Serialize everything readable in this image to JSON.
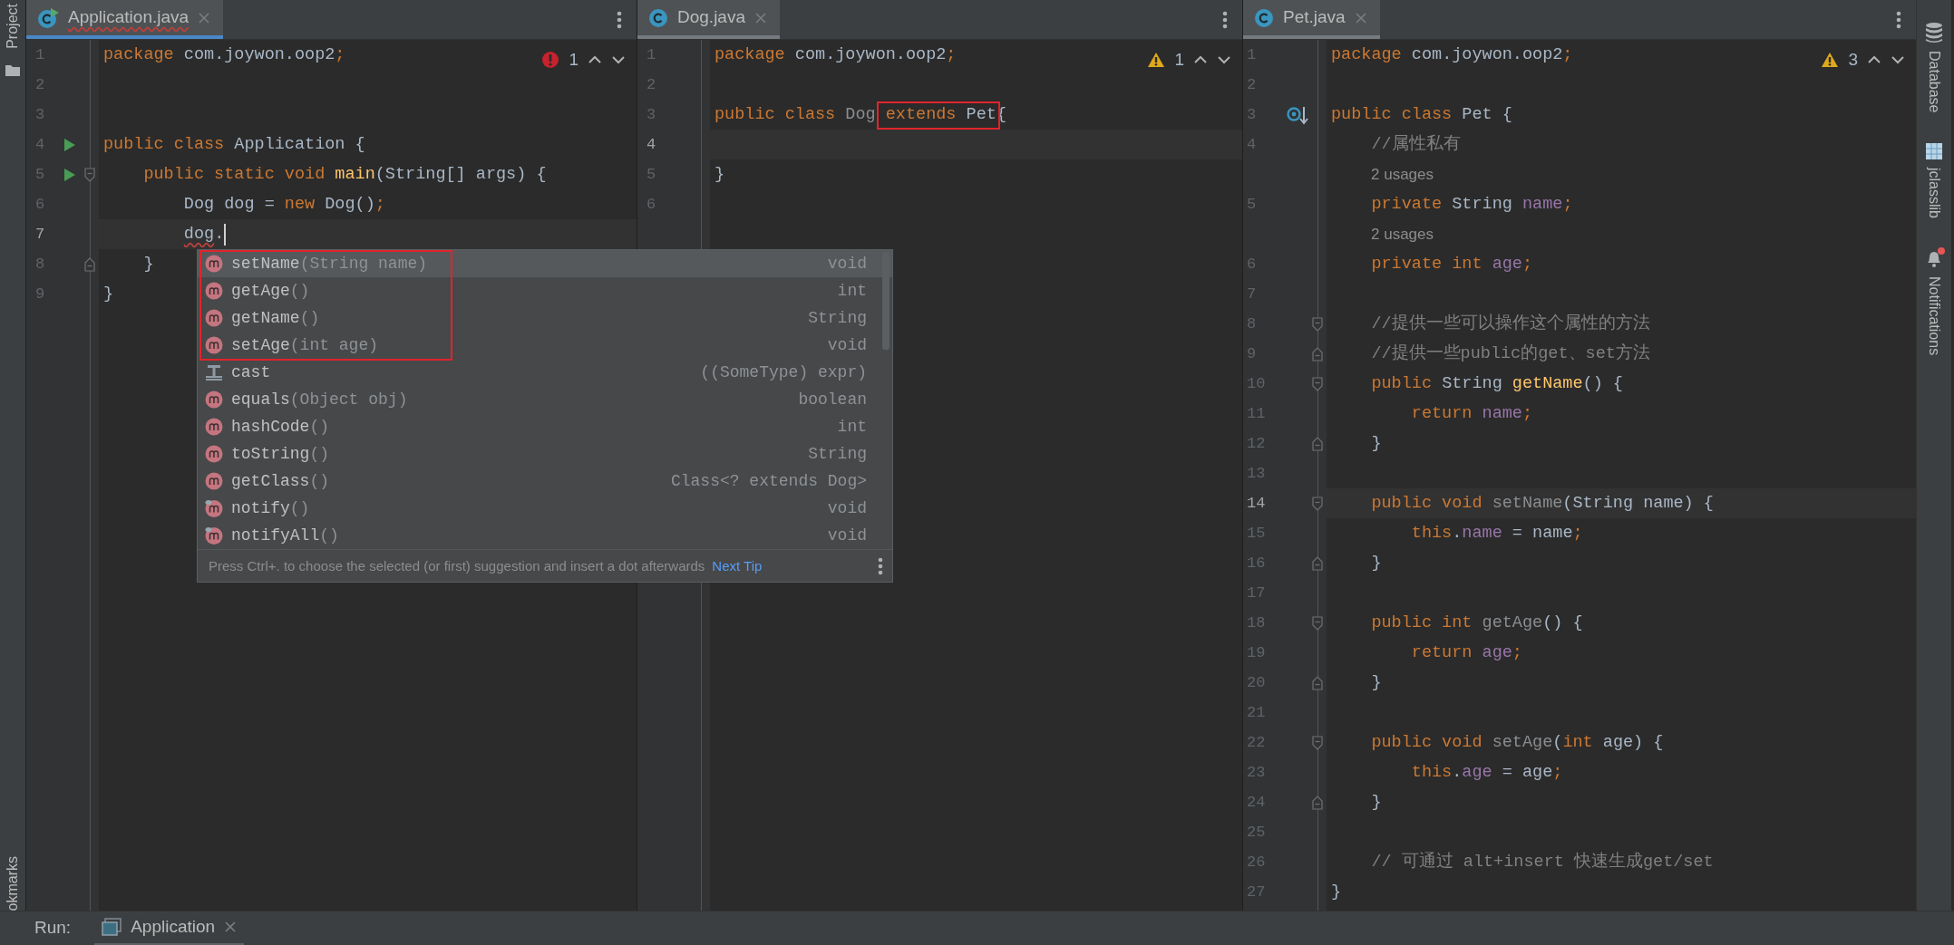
{
  "left_stripe": {
    "items": [
      {
        "label": "Project",
        "kind": "folder"
      }
    ],
    "bottom_label": "okmarks"
  },
  "panes": [
    {
      "tab": {
        "label": "Application.java",
        "kind": "runnable-class",
        "selected": true,
        "focused": true,
        "error": true
      },
      "inspection": {
        "kind": "error",
        "count": "1"
      },
      "lines": [
        {
          "n": "1",
          "current": false,
          "tokens": [
            {
              "kind": "kw",
              "text": "package"
            },
            {
              "kind": "id",
              "text": " com.joywon.oop2"
            },
            {
              "kind": "kw",
              "text": ";"
            }
          ]
        },
        {
          "n": "2",
          "current": false
        },
        {
          "n": "3",
          "current": false
        },
        {
          "n": "4",
          "current": false,
          "gutter_icon": {
            "kind": "run"
          },
          "tokens": [
            {
              "kind": "kw",
              "text": "public class "
            },
            {
              "kind": "id",
              "text": "Application {"
            }
          ]
        },
        {
          "n": "5",
          "current": false,
          "gutter_icon": {
            "kind": "run"
          },
          "fold": {
            "kind": "start"
          },
          "tokens": [
            {
              "kind": "kw",
              "text": "    public static void "
            },
            {
              "kind": "fn",
              "text": "main"
            },
            {
              "kind": "id",
              "text": "(String[] args) {"
            }
          ]
        },
        {
          "n": "6",
          "current": false,
          "tokens": [
            {
              "kind": "id",
              "text": "        Dog dog = "
            },
            {
              "kind": "kw",
              "text": "new "
            },
            {
              "kind": "id",
              "text": "Dog()"
            },
            {
              "kind": "kw",
              "text": ";"
            }
          ]
        },
        {
          "n": "7",
          "current": true,
          "tokens": [
            {
              "kind": "err",
              "text": "        dog"
            },
            {
              "kind": "id",
              "text": "."
            }
          ]
        },
        {
          "n": "8",
          "current": false,
          "fold": {
            "kind": "end"
          },
          "tokens": [
            {
              "kind": "id",
              "text": "    }"
            }
          ]
        },
        {
          "n": "9",
          "current": false,
          "tokens": [
            {
              "kind": "id",
              "text": "}"
            }
          ]
        }
      ]
    },
    {
      "tab": {
        "label": "Dog.java",
        "kind": "class",
        "selected": true,
        "focused": false,
        "error": false
      },
      "inspection": {
        "kind": "warning",
        "count": "1"
      },
      "lines": [
        {
          "n": "1",
          "current": false,
          "tokens": [
            {
              "kind": "kw",
              "text": "package"
            },
            {
              "kind": "id",
              "text": " com.joywon.oop2"
            },
            {
              "kind": "kw",
              "text": ";"
            }
          ]
        },
        {
          "n": "2",
          "current": false
        },
        {
          "n": "3",
          "current": false,
          "tokens": [
            {
              "kind": "kw",
              "text": "public class "
            },
            {
              "kind": "unused",
              "text": "Dog "
            },
            {
              "kind": "kw",
              "text": "extends",
              "boxed": true
            },
            {
              "kind": "id",
              "text": " Pet",
              "boxed": true
            },
            {
              "kind": "id",
              "text": "{"
            }
          ]
        },
        {
          "n": "4",
          "current": true
        },
        {
          "n": "5",
          "current": false,
          "tokens": [
            {
              "kind": "id",
              "text": "}"
            }
          ]
        },
        {
          "n": "6",
          "current": false
        }
      ]
    },
    {
      "tab": {
        "label": "Pet.java",
        "kind": "class",
        "selected": true,
        "focused": false,
        "error": false
      },
      "inspection": {
        "kind": "warning",
        "count": "3"
      },
      "lines": [
        {
          "n": "1",
          "current": false,
          "tokens": [
            {
              "kind": "kw",
              "text": "package"
            },
            {
              "kind": "id",
              "text": " com.joywon.oop2"
            },
            {
              "kind": "kw",
              "text": ";"
            }
          ]
        },
        {
          "n": "2",
          "current": false
        },
        {
          "n": "3",
          "current": false,
          "gutter_icon": {
            "kind": "override"
          },
          "tokens": [
            {
              "kind": "kw",
              "text": "public class "
            },
            {
              "kind": "id",
              "text": "Pet {"
            }
          ]
        },
        {
          "n": "4",
          "current": false,
          "tokens": [
            {
              "kind": "cm",
              "text": "    //属性私有"
            }
          ]
        },
        {
          "hint": "2 usages"
        },
        {
          "n": "5",
          "current": false,
          "tokens": [
            {
              "kind": "kw",
              "text": "    private "
            },
            {
              "kind": "id",
              "text": "String "
            },
            {
              "kind": "fld",
              "text": "name"
            },
            {
              "kind": "kw",
              "text": ";"
            }
          ]
        },
        {
          "hint": "2 usages"
        },
        {
          "n": "6",
          "current": false,
          "tokens": [
            {
              "kind": "kw",
              "text": "    private int "
            },
            {
              "kind": "fld",
              "text": "age"
            },
            {
              "kind": "kw",
              "text": ";"
            }
          ]
        },
        {
          "n": "7",
          "current": false
        },
        {
          "n": "8",
          "current": false,
          "fold": {
            "kind": "start"
          },
          "tokens": [
            {
              "kind": "cm",
              "text": "    //提供一些可以操作这个属性的方法"
            }
          ]
        },
        {
          "n": "9",
          "current": false,
          "fold": {
            "kind": "end"
          },
          "tokens": [
            {
              "kind": "cm",
              "text": "    //提供一些public的get、set方法"
            }
          ]
        },
        {
          "n": "10",
          "current": false,
          "fold": {
            "kind": "start"
          },
          "tokens": [
            {
              "kind": "kw",
              "text": "    public "
            },
            {
              "kind": "id",
              "text": "String "
            },
            {
              "kind": "fn",
              "text": "getName"
            },
            {
              "kind": "id",
              "text": "() {"
            }
          ]
        },
        {
          "n": "11",
          "current": false,
          "tokens": [
            {
              "kind": "kw",
              "text": "        return "
            },
            {
              "kind": "fld",
              "text": "name"
            },
            {
              "kind": "kw",
              "text": ";"
            }
          ]
        },
        {
          "n": "12",
          "current": false,
          "fold": {
            "kind": "end"
          },
          "tokens": [
            {
              "kind": "id",
              "text": "    }"
            }
          ]
        },
        {
          "n": "13",
          "current": false
        },
        {
          "n": "14",
          "current": true,
          "fold": {
            "kind": "start"
          },
          "tokens": [
            {
              "kind": "kw",
              "text": "    public void "
            },
            {
              "kind": "unused",
              "text": "setName"
            },
            {
              "kind": "id",
              "text": "(String name) {"
            }
          ]
        },
        {
          "n": "15",
          "current": false,
          "tokens": [
            {
              "kind": "kw",
              "text": "        this"
            },
            {
              "kind": "id",
              "text": "."
            },
            {
              "kind": "fld",
              "text": "name"
            },
            {
              "kind": "id",
              "text": " = name"
            },
            {
              "kind": "kw",
              "text": ";"
            }
          ]
        },
        {
          "n": "16",
          "current": false,
          "fold": {
            "kind": "end"
          },
          "tokens": [
            {
              "kind": "id",
              "text": "    }"
            }
          ]
        },
        {
          "n": "17",
          "current": false
        },
        {
          "n": "18",
          "current": false,
          "fold": {
            "kind": "start"
          },
          "tokens": [
            {
              "kind": "kw",
              "text": "    public int "
            },
            {
              "kind": "unused",
              "text": "getAge"
            },
            {
              "kind": "id",
              "text": "() {"
            }
          ]
        },
        {
          "n": "19",
          "current": false,
          "tokens": [
            {
              "kind": "kw",
              "text": "        return "
            },
            {
              "kind": "fld",
              "text": "age"
            },
            {
              "kind": "kw",
              "text": ";"
            }
          ]
        },
        {
          "n": "20",
          "current": false,
          "fold": {
            "kind": "end"
          },
          "tokens": [
            {
              "kind": "id",
              "text": "    }"
            }
          ]
        },
        {
          "n": "21",
          "current": false
        },
        {
          "n": "22",
          "current": false,
          "fold": {
            "kind": "start"
          },
          "tokens": [
            {
              "kind": "kw",
              "text": "    public void "
            },
            {
              "kind": "unused",
              "text": "setAge"
            },
            {
              "kind": "id",
              "text": "("
            },
            {
              "kind": "kw",
              "text": "int "
            },
            {
              "kind": "id",
              "text": "age) {"
            }
          ]
        },
        {
          "n": "23",
          "current": false,
          "tokens": [
            {
              "kind": "kw",
              "text": "        this"
            },
            {
              "kind": "id",
              "text": "."
            },
            {
              "kind": "fld",
              "text": "age"
            },
            {
              "kind": "id",
              "text": " = age"
            },
            {
              "kind": "kw",
              "text": ";"
            }
          ]
        },
        {
          "n": "24",
          "current": false,
          "fold": {
            "kind": "end"
          },
          "tokens": [
            {
              "kind": "id",
              "text": "    }"
            }
          ]
        },
        {
          "n": "25",
          "current": false
        },
        {
          "n": "26",
          "current": false,
          "tokens": [
            {
              "kind": "cm",
              "text": "    // 可通过 alt+insert 快速生成get/set"
            }
          ]
        },
        {
          "n": "27",
          "current": false,
          "tokens": [
            {
              "kind": "id",
              "text": "}"
            }
          ]
        }
      ]
    }
  ],
  "completion_popup": {
    "items": [
      {
        "name": "setName",
        "params": "(String name)",
        "type": "void",
        "kind": "method",
        "selected": true,
        "boxed": true
      },
      {
        "name": "getAge",
        "params": "()",
        "type": "int",
        "kind": "method",
        "selected": false,
        "boxed": true
      },
      {
        "name": "getName",
        "params": "()",
        "type": "String",
        "kind": "method",
        "selected": false,
        "boxed": true
      },
      {
        "name": "setAge",
        "params": "(int age)",
        "type": "void",
        "kind": "method",
        "selected": false,
        "boxed": true
      },
      {
        "name": "cast",
        "type": "((SomeType) expr)",
        "kind": "template",
        "selected": false,
        "boxed": false
      },
      {
        "name": "equals",
        "params": "(Object obj)",
        "type": "boolean",
        "kind": "method",
        "selected": false,
        "boxed": false
      },
      {
        "name": "hashCode",
        "params": "()",
        "type": "int",
        "kind": "method",
        "selected": false,
        "boxed": false
      },
      {
        "name": "toString",
        "params": "()",
        "type": "String",
        "kind": "method",
        "selected": false,
        "boxed": false
      },
      {
        "name": "getClass",
        "params": "()",
        "type": "Class<? extends Dog>",
        "kind": "method",
        "selected": false,
        "boxed": false
      },
      {
        "name": "notify",
        "params": "()",
        "type": "void",
        "kind": "inherited-method",
        "selected": false,
        "boxed": false
      },
      {
        "name": "notifyAll",
        "params": "()",
        "type": "void",
        "kind": "inherited-method",
        "selected": false,
        "boxed": false
      }
    ],
    "hint": "Press Ctrl+. to choose the selected (or first) suggestion and insert a dot afterwards",
    "link": "Next Tip"
  },
  "right_stripe": {
    "items": [
      {
        "label": "Database",
        "kind": "database",
        "badge": false
      },
      {
        "label": "jclasslib",
        "kind": "grid",
        "badge": false
      },
      {
        "label": "Notifications",
        "kind": "bell",
        "badge": true
      }
    ]
  },
  "run_bar": {
    "label": "Run:",
    "tabs": [
      {
        "label": "Application",
        "selected": true
      }
    ]
  }
}
